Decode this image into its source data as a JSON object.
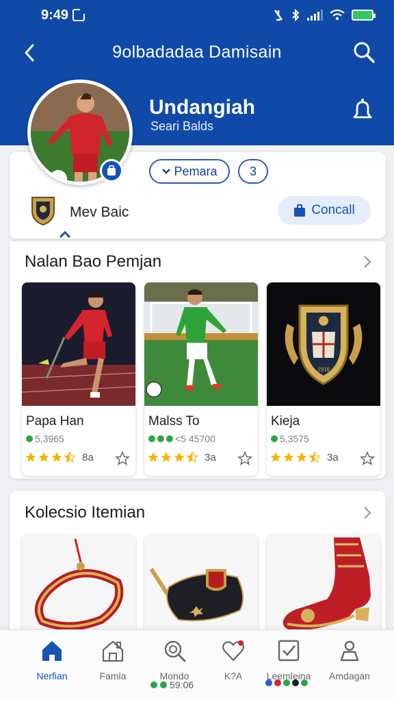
{
  "status_bar": {
    "time": "9:49"
  },
  "header": {
    "title": "9olbadadaa Damisain",
    "profile_name": "Undangiah",
    "profile_subtitle": "Seari Balds"
  },
  "profile": {
    "follow_label": "Pemara",
    "count_label": "3",
    "club_name": "Mev Baic",
    "connect_label": "Concall"
  },
  "section_players": {
    "title": "Nalan Bao Pemjan",
    "cards": [
      {
        "name": "Papa Han",
        "stat": "5,3965",
        "rating": "8a"
      },
      {
        "name": "Malss To",
        "stat": "<5 45700",
        "rating": "3a"
      },
      {
        "name": "Kieja",
        "stat": "5,3575",
        "rating": "3a"
      }
    ]
  },
  "section_collection": {
    "title": "Kolecsio Itemian"
  },
  "bottom_nav": {
    "items": [
      {
        "label": "Nerfian"
      },
      {
        "label": "Famla"
      },
      {
        "label": "Mondo"
      },
      {
        "label": "K?A"
      },
      {
        "label": "Leemleina"
      },
      {
        "label": "Amdagan"
      }
    ],
    "extra_value": "59:06"
  },
  "colors": {
    "primary": "#0f4aa8",
    "star": "#f4b400",
    "active_nav": "#1453b5"
  },
  "icons": [
    "back-arrow-icon",
    "search-icon",
    "bell-icon",
    "home-icon",
    "house-icon",
    "magnifier-icon",
    "heart-icon",
    "checkbox-icon",
    "user-icon",
    "star-icon",
    "chevron-right-icon"
  ]
}
